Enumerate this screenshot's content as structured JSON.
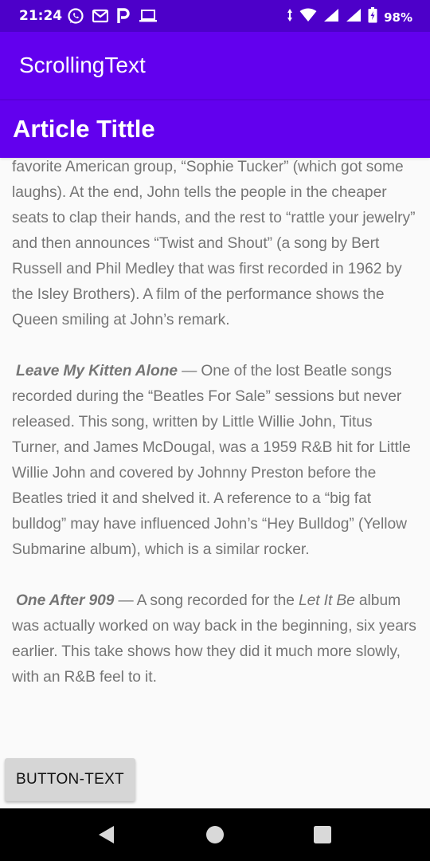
{
  "status_bar": {
    "time": "21:24",
    "battery": "98%",
    "icons_left": [
      "whatsapp-icon",
      "gmail-icon",
      "p-icon",
      "laptop-icon"
    ],
    "icons_right": [
      "data-arrows-icon",
      "wifi-icon",
      "signal-icon",
      "signal-icon",
      "battery-icon"
    ]
  },
  "app_bar": {
    "title": "ScrollingText"
  },
  "article": {
    "heading": "Article Tittle",
    "p1": "favorite American group, “Sophie Tucker” (which got some laughs). At the end, John tells the people in the cheaper seats to clap their hands, and the rest to “rattle your jewelry” and then announces “Twist and Shout” (a song by Bert Russell and Phil Medley that was first recorded in 1962 by the Isley Brothers). A film of the performance shows the Queen smiling at John’s remark.",
    "p2_title": "Leave My Kitten Alone",
    "p2_text": " — One of the lost Beatle songs recorded during the “Beatles For Sale” sessions but never released. This song, written by Little Willie John, Titus Turner, and James McDougal, was a 1959 R&B hit for Little Willie John and covered by Johnny Preston before the Beatles tried it and shelved it. A reference to a “big fat bulldog” may have influenced John’s “Hey Bulldog” (Yellow Submarine album), which is a similar rocker.",
    "p3_title": "One After 909",
    "p3_text_a": " — A song recorded for the ",
    "p3_album": "Let It Be",
    "p3_text_b": " album was actually worked on way back in the beginning, six years earlier. This take shows how they did it much more slowly, with an R&B feel to it."
  },
  "button": {
    "label": "BUTTON-TEXT"
  },
  "nav_bar": {
    "buttons": [
      "back-icon",
      "home-icon",
      "recents-icon"
    ]
  },
  "colors": {
    "status_bar": "#4d00c9",
    "primary": "#6200ee",
    "body_text": "#757575",
    "button_bg": "#d6d6d6"
  }
}
